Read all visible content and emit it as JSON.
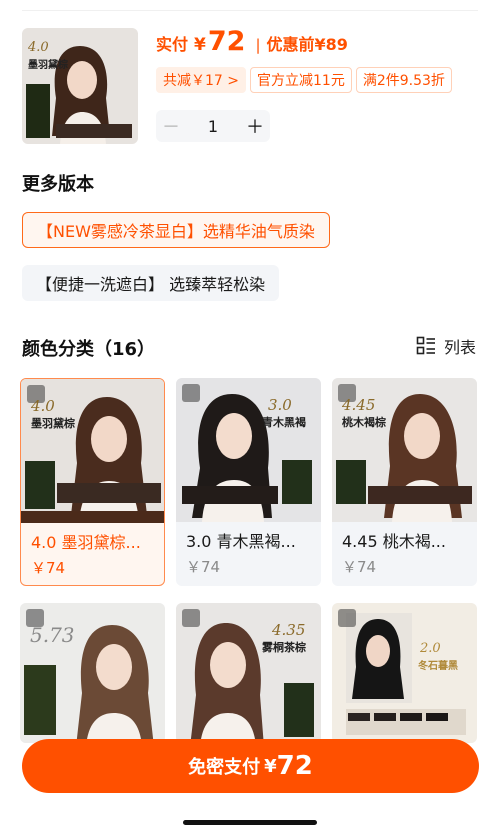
{
  "header": {
    "pay_label": "实付",
    "currency": "¥",
    "pay_amount": "72",
    "pre_sep": "|",
    "pre_label": "优惠前",
    "pre_amount": "¥89",
    "thumb_badge": "4.0",
    "thumb_title": "墨羽黛棕"
  },
  "promos": [
    {
      "label": "共减￥17 >"
    },
    {
      "label": "官方立减11元"
    },
    {
      "label": "满2件9.53折"
    }
  ],
  "stepper": {
    "minus": "－",
    "quantity": "1",
    "plus": "＋"
  },
  "versions": {
    "title": "更多版本",
    "items": [
      {
        "label": "【NEW雾感冷茶显白】选精华油气质染"
      },
      {
        "label": "【便捷一洗遮白】 选臻萃轻松染"
      }
    ]
  },
  "colors": {
    "title": "颜色分类（16）",
    "toggle_label": "列表",
    "cards": [
      {
        "name": "4.0 墨羽黛棕...",
        "price": "￥74",
        "badge": "4.0",
        "subtitle": "墨羽黛棕",
        "hair": "#4a2c1e",
        "bg": "#e6e2de"
      },
      {
        "name": "3.0 青木黑褐...",
        "price": "￥74",
        "badge": "3.0",
        "subtitle": "青木黑褐",
        "hair": "#1f1a18",
        "bg": "#e4e4e6"
      },
      {
        "name": "4.45 桃木褐...",
        "price": "￥74",
        "badge": "4.45",
        "subtitle": "桃木褐棕",
        "hair": "#5a3524",
        "bg": "#e8e6e4"
      },
      {
        "badge": "5.73",
        "subtitle": "",
        "hair": "#6b4a36",
        "bg": "#ececea"
      },
      {
        "badge": "4.35",
        "subtitle": "雾桐茶棕",
        "hair": "#5b3a2c",
        "bg": "#e8e6e4"
      },
      {
        "badge": "2.0",
        "subtitle": "冬石暮黑",
        "hair": "#151515",
        "bg": "#f2ede4"
      }
    ]
  },
  "paybar": {
    "label": "免密支付",
    "currency": "¥",
    "amount": "72"
  },
  "colors_theme": {
    "accent": "#ff5000",
    "chip_bg": "#fff0e6",
    "card_bg": "#f3f5f8"
  }
}
